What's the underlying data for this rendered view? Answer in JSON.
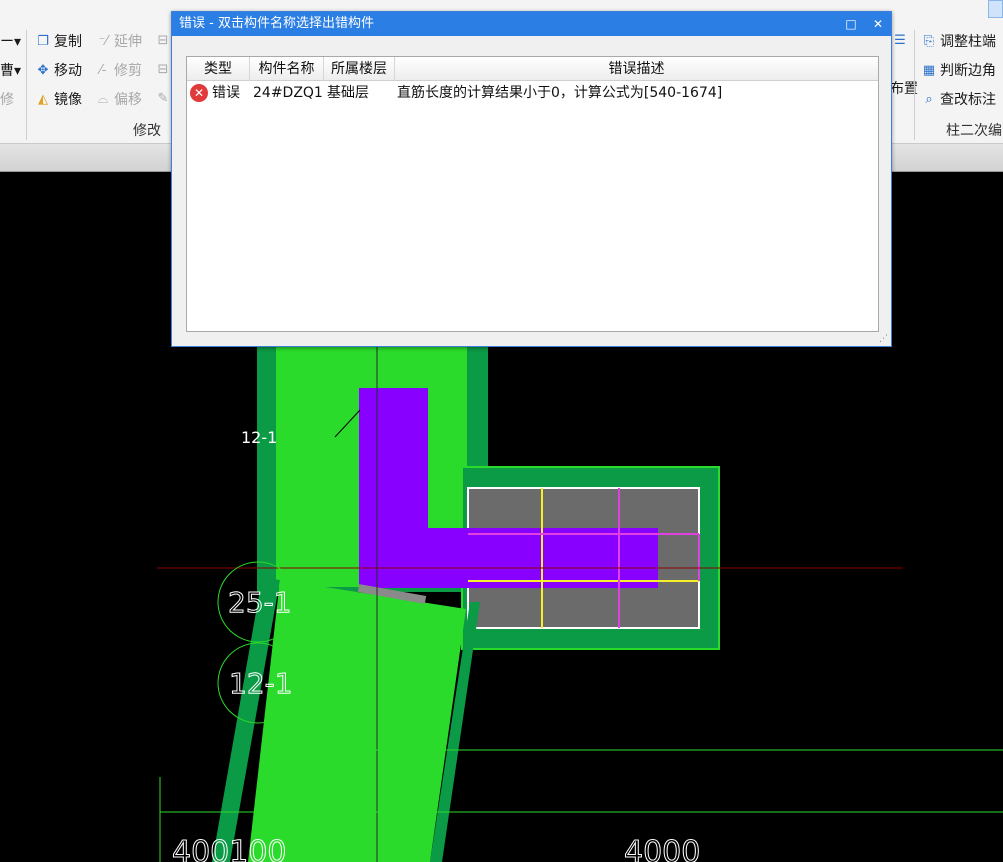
{
  "ribbon": {
    "left_buttons": {
      "copy": "复制",
      "extend": "延伸",
      "move": "移动",
      "trim": "修剪",
      "mirror": "镜像",
      "offset": "偏移"
    },
    "modify_group_label": "修改",
    "right_buttons": {
      "adjust_column_end": "调整柱端",
      "judge_corner": "判断边角",
      "modify_annotation": "查改标注",
      "layout": "布置"
    },
    "column_secondary_label": "柱二次编"
  },
  "dialog": {
    "title": "错误 - 双击构件名称选择出错构件",
    "maximize_glyph": "□",
    "close_glyph": "✕",
    "columns": [
      "类型",
      "构件名称",
      "所属楼层",
      "错误描述"
    ],
    "rows": [
      {
        "type": "错误",
        "component": "24#DZQ1",
        "floor": "基础层",
        "description": "直筋长度的计算结果小于0，计算公式为[540-1674]"
      }
    ]
  },
  "cad": {
    "labels": {
      "label_12_1_small": "12-1",
      "label_25_1": "25-1",
      "label_12_1_circle": "12-1",
      "dim_left": "400100",
      "dim_right": "4000"
    },
    "colors": {
      "background": "#000000",
      "wall_fill": "#2bdb2b",
      "wall_border": "#0b9a45",
      "column": "#8800ff",
      "foundation": "#6b6b6b",
      "rebar_yellow": "#f5ef2a",
      "rebar_magenta": "#e040e0",
      "axis": "#8b0000"
    }
  }
}
